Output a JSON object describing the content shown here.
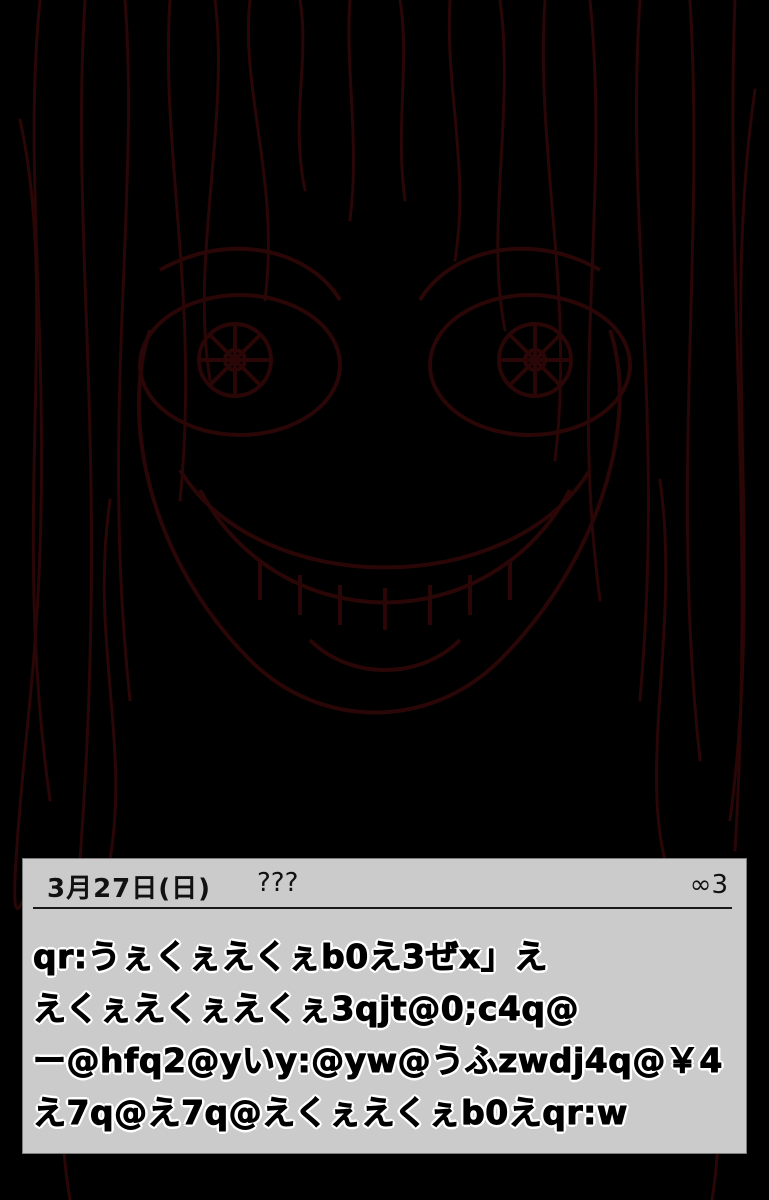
{
  "diary": {
    "date": "3月27日(日)",
    "weather": "???",
    "counter": "∞3",
    "lines": [
      "qr:うぇくぇえくぇb0え3ぜx」え",
      "えくぇえくぇえくぇ3qjt@0;c4q@",
      "ー@hfq2@yいy:@yw@うふzwdj4q@￥4",
      "え7q@え7q@えくぇえくぇb0えqr:w"
    ]
  },
  "colors": {
    "background": "#000000",
    "card": "#cbcbcb",
    "face_lines": "#2a0606"
  }
}
